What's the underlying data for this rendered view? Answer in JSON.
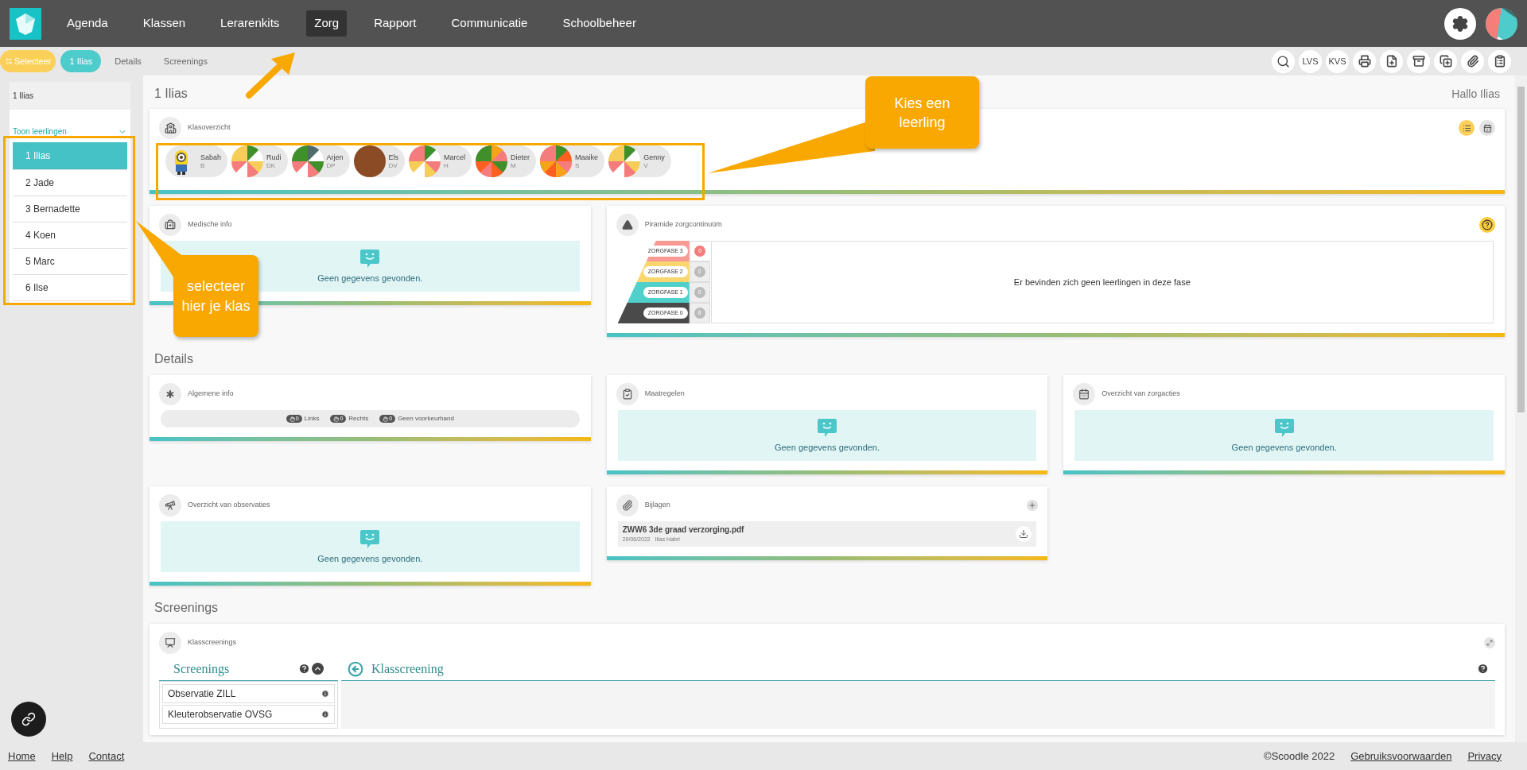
{
  "nav": {
    "items": [
      {
        "label": "Agenda",
        "selected": false
      },
      {
        "label": "Klassen",
        "selected": false
      },
      {
        "label": "Lerarenkits",
        "selected": false
      },
      {
        "label": "Zorg",
        "selected": true
      },
      {
        "label": "Rapport",
        "selected": false
      },
      {
        "label": "Communicatie",
        "selected": false
      },
      {
        "label": "Schoolbeheer",
        "selected": false
      }
    ]
  },
  "subnav": {
    "select_button": "Selecteer",
    "tabs": [
      {
        "label": "1 Ilias",
        "selected": true
      },
      {
        "label": "Details",
        "selected": false
      },
      {
        "label": "Screenings",
        "selected": false
      }
    ]
  },
  "toolbar_labels": [
    "LVS",
    "KVS"
  ],
  "sidebar": {
    "current": "1 Ilias",
    "toggle": "Toon leerlingen",
    "expanded": true,
    "classes": [
      {
        "label": "1 Ilias",
        "selected": true
      },
      {
        "label": "2 Jade",
        "selected": false
      },
      {
        "label": "3 Bernadette",
        "selected": false
      },
      {
        "label": "4 Koen",
        "selected": false
      },
      {
        "label": "5 Marc",
        "selected": false
      },
      {
        "label": "6 Ilse",
        "selected": false
      }
    ]
  },
  "page": {
    "title": "1 Ilias",
    "greeting": "Hallo Ilias"
  },
  "class_overview": {
    "title": "Klasoverzicht",
    "views": [
      {
        "selected": true
      },
      {
        "selected": false
      }
    ],
    "students": [
      {
        "name": "Sabah",
        "initials": "B",
        "kind": "mascot"
      },
      {
        "name": "Rudi",
        "initials": "DK",
        "kind": "pattern"
      },
      {
        "name": "Arjen",
        "initials": "DP",
        "kind": "pattern"
      },
      {
        "name": "Els",
        "initials": "DV",
        "kind": "photo"
      },
      {
        "name": "Marcel",
        "initials": "H",
        "kind": "pattern"
      },
      {
        "name": "Dieter",
        "initials": "M",
        "kind": "pattern"
      },
      {
        "name": "Maaike",
        "initials": "S",
        "kind": "pattern"
      },
      {
        "name": "Genny",
        "initials": "V",
        "kind": "pattern"
      }
    ]
  },
  "medical": {
    "title": "Medische info",
    "empty": "Geen gegevens gevonden."
  },
  "pyramid": {
    "title": "Piramide zorgcontinuüm",
    "message": "Er bevinden zich geen leerlingen in deze fase",
    "phases": [
      {
        "label": "ZORGFASE 3",
        "count": "0",
        "color": "#f79a94",
        "selected": true
      },
      {
        "label": "ZORGFASE 2",
        "count": "0",
        "color": "#fbd56e",
        "selected": false
      },
      {
        "label": "ZORGFASE 1",
        "count": "0",
        "color": "#4fd0cb",
        "selected": false
      },
      {
        "label": "ZORGFASE 0",
        "count": "8",
        "color": "#4a4a4a",
        "selected": false
      }
    ]
  },
  "details_heading": "Details",
  "general": {
    "title": "Algemene info",
    "hands": [
      {
        "count": "0",
        "label": "Links"
      },
      {
        "count": "0",
        "label": "Rechts"
      },
      {
        "count": "0",
        "label": "Geen voorkeurhand"
      }
    ]
  },
  "measures": {
    "title": "Maatregelen",
    "empty": "Geen gegevens gevonden."
  },
  "care_actions": {
    "title": "Overzicht van zorgacties",
    "empty": "Geen gegevens gevonden."
  },
  "observations": {
    "title": "Overzicht van observaties",
    "empty": "Geen gegevens gevonden."
  },
  "attachments": {
    "title": "Bijlagen",
    "files": [
      {
        "name": "ZWW6 3de graad verzorging.pdf",
        "date": "29/06/2022",
        "author": "Ilias Habri"
      }
    ]
  },
  "screenings_heading": "Screenings",
  "class_screenings": {
    "title": "Klasscreenings",
    "list_title": "Screenings",
    "items": [
      "Observatie ZILL",
      "Kleuterobservatie OVSG"
    ],
    "detail_title": "Klasscreening"
  },
  "footer": {
    "links": [
      "Home",
      "Help",
      "Contact"
    ],
    "copyright": "©Scoodle 2022",
    "legal_links": [
      "Gebruiksvoorwaarden",
      "Privacy"
    ]
  },
  "callouts": [
    "Kies een leerling",
    "selecteer hier je klas"
  ]
}
